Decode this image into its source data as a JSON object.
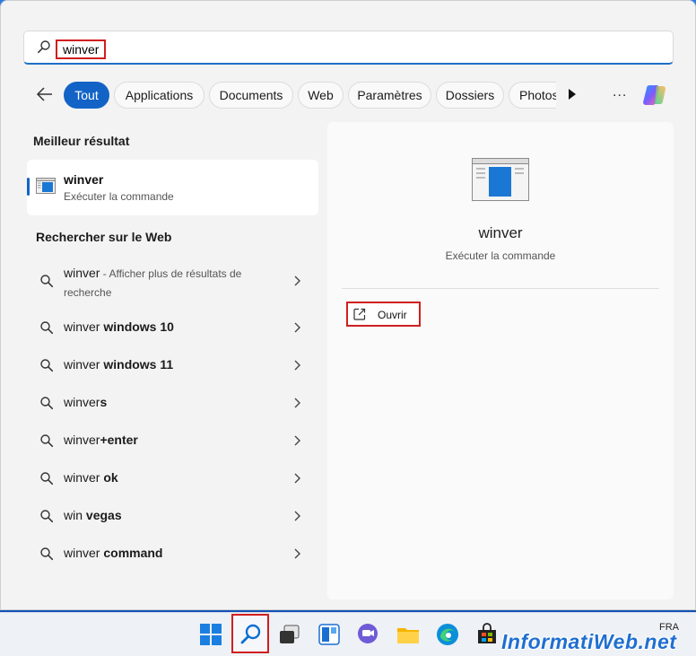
{
  "search": {
    "query": "winver"
  },
  "filters": {
    "items": [
      {
        "label": "Tout",
        "active": true
      },
      {
        "label": "Applications"
      },
      {
        "label": "Documents"
      },
      {
        "label": "Web"
      },
      {
        "label": "Paramètres"
      },
      {
        "label": "Dossiers"
      },
      {
        "label": "Photos"
      }
    ],
    "more_label": "..."
  },
  "best_match": {
    "section_title": "Meilleur résultat",
    "title": "winver",
    "subtitle": "Exécuter la commande"
  },
  "web": {
    "section_title": "Rechercher sur le Web",
    "first": {
      "prefix": "winver",
      "suffix": " - Afficher plus de résultats de recherche"
    },
    "items": [
      {
        "prefix": "winver",
        "suffix": " windows 10"
      },
      {
        "prefix": "winver",
        "suffix": " windows 11"
      },
      {
        "prefix": "winver",
        "suffix": "s"
      },
      {
        "prefix": "winver",
        "suffix": "+enter"
      },
      {
        "prefix": "winver",
        "suffix": " ok"
      },
      {
        "prefix": "win",
        "suffix": " vegas"
      },
      {
        "prefix": "winver",
        "suffix": " command"
      }
    ]
  },
  "detail": {
    "title": "winver",
    "subtitle": "Exécuter la commande",
    "open_label": "Ouvrir"
  },
  "taskbar": {
    "lang": "FRA",
    "watermark": "InformatiWeb.net"
  },
  "colors": {
    "accent": "#1363c7",
    "highlight": "#d01f1f"
  }
}
